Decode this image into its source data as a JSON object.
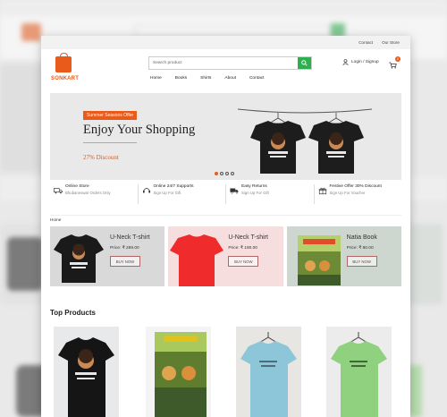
{
  "brand": {
    "name": "SONKART",
    "accent": "#e85b1a",
    "search_green": "#2eae4e"
  },
  "utility_links": [
    "Contact",
    "Our Store"
  ],
  "search": {
    "placeholder": "Search product"
  },
  "account": {
    "label": "Login / Signup",
    "icon": "user-icon"
  },
  "cart": {
    "count": "0",
    "icon": "cart-icon"
  },
  "nav": [
    "Home",
    "Books",
    "Shirts",
    "About",
    "Contact"
  ],
  "banner": {
    "offer": "Summer Seasons Offer",
    "title": "Enjoy Your Shopping",
    "discount": "27% Discount",
    "slides": 4,
    "active_slide": 1
  },
  "features": [
    {
      "icon": "truck-icon",
      "title": "Online Store",
      "subtitle": "Bhubaneswar Orders Only"
    },
    {
      "icon": "headset-icon",
      "title": "Online 24/7 Supports",
      "subtitle": "Sign Up For Gift"
    },
    {
      "icon": "return-truck-icon",
      "title": "Easy Returns",
      "subtitle": "Sign Up For Gift"
    },
    {
      "icon": "gift-icon",
      "title": "Festive Offer 30% Discount",
      "subtitle": "Sign Up For Voucher"
    }
  ],
  "breadcrumb": "Home",
  "categories": [
    {
      "name": "U-Neck T-shirt",
      "price": "Price: ₹ 289.00",
      "button": "BUY NOW",
      "bg": "#d9d9d9",
      "product": "black-tshirt"
    },
    {
      "name": "U-Neck T-shirt",
      "price": "Price: ₹ 180.00",
      "button": "BUY NOW",
      "bg": "#f7dede",
      "product": "red-tshirt"
    },
    {
      "name": "Natia Book",
      "price": "Price: ₹ 80.00",
      "button": "BUY NOW",
      "bg": "#cdd6cf",
      "product": "book"
    }
  ],
  "top_products": {
    "title": "Top Products",
    "items": [
      {
        "product": "black-tshirt",
        "bg": "#e7e9ea"
      },
      {
        "product": "book",
        "bg": "#f4f4f4"
      },
      {
        "product": "blue-tshirt",
        "bg": "#e8e6e3"
      },
      {
        "product": "green-tshirt",
        "bg": "#ececec"
      }
    ]
  }
}
